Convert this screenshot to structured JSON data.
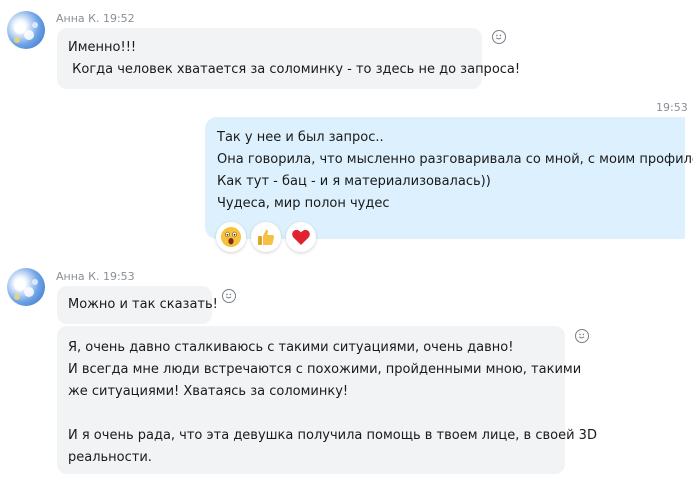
{
  "messages": [
    {
      "author": "Анна К.",
      "time": "19:52",
      "lines": [
        "Именно!!!",
        " Когда человек хватается за соломинку - то здесь не до запроса!"
      ]
    },
    {
      "time": "19:53",
      "lines": [
        "Так у нее и был запрос..",
        "Она говорила, что мысленно разговаривала со мной, с моим профилем.",
        "Как тут - бац - и я материализовалась))",
        "Чудеса, мир полон чудес"
      ],
      "reactions": [
        "surprised-emoji",
        "thumbs-up-emoji",
        "heart-emoji"
      ]
    },
    {
      "author": "Анна К.",
      "time": "19:53",
      "lines": [
        "Можно и так сказать!"
      ]
    },
    {
      "lines": [
        "Я, очень давно сталкиваюсь с такими ситуациями, очень давно!",
        "И всегда мне люди встречаются с похожими, пройденными мною, такими",
        "же ситуациями! Хватаясь за соломинку!",
        "",
        "И я очень рада, что эта девушка получила помощь в твоем лице, в своей 3D",
        "реальности."
      ]
    }
  ],
  "icons": {
    "react": "smiley-icon"
  },
  "colors": {
    "incoming_bubble": "#f1f3f5",
    "outgoing_bubble": "#dcf0fd",
    "meta_text": "#8a8f96"
  }
}
